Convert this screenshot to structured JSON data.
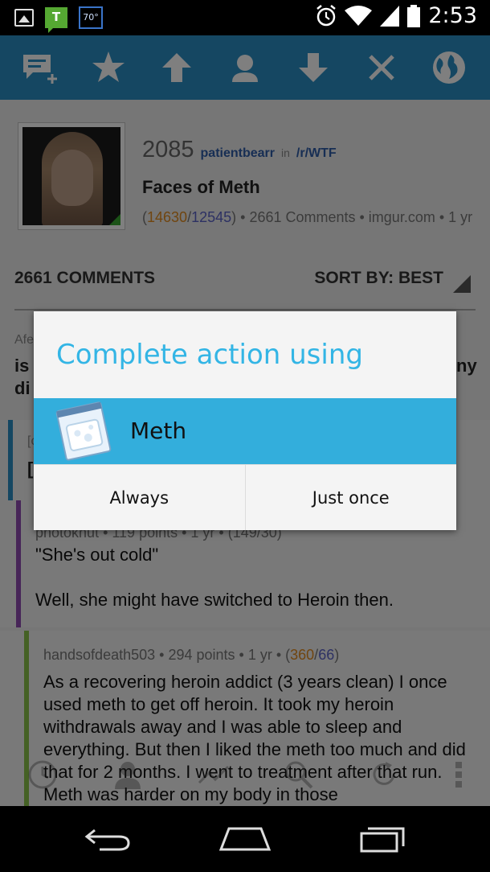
{
  "status_bar": {
    "temp_badge": "70°",
    "t_badge": "T",
    "time": "2:53",
    "icons": [
      "image-icon",
      "talk-icon",
      "weather-icon",
      "alarm-icon",
      "wifi-icon",
      "signal-icon",
      "battery-icon"
    ]
  },
  "toolbar": {
    "icons": [
      "add-comment-icon",
      "star-icon",
      "upvote-icon",
      "user-icon",
      "downvote-icon",
      "close-icon",
      "globe-icon"
    ],
    "color": "#2b8fc4"
  },
  "post": {
    "score": "2085",
    "author": "patientbearr",
    "in_label": "in",
    "subreddit": "/r/WTF",
    "title": "Faces of Meth",
    "meta_open": "(",
    "ups": "14630",
    "sep": "/",
    "downs": "12545",
    "meta_rest": ") • 2661 Comments • imgur.com • 1 yr"
  },
  "comments_header": {
    "count_label": "2661 COMMENTS",
    "sort_label": "SORT BY: BEST"
  },
  "obscured_fragments": {
    "a": "Afe",
    "b": "is",
    "c": "di",
    "d": "ny",
    "e": "[c",
    "f": "["
  },
  "comments": [
    {
      "head": "photoknut • 119 points • 1 yr • (149/30)",
      "lines": [
        "\"She's out cold\"",
        "Well, she might have switched to Heroin then."
      ]
    },
    {
      "author": "handsofdeath503",
      "head_rest": " • 294 points • 1 yr • (",
      "ups": "360",
      "sep": "/",
      "downs": "66",
      "close": ")",
      "body": "As a recovering heroin addict (3 years clean) I once used meth to get off heroin. It took my heroin withdrawals away and I was able to sleep and everything. But then I liked the meth too much and did that for 2 months. I went to treatment after that run. Meth was harder on my body in those"
    }
  ],
  "bottom_nav": {
    "icons": [
      "history-icon",
      "user-icon",
      "trend-icon",
      "search-icon",
      "refresh-icon",
      "overflow-menu-icon"
    ]
  },
  "dialog": {
    "title": "Complete action using",
    "app_label": "Meth",
    "always_label": "Always",
    "once_label": "Just once",
    "accent": "#33b5e5",
    "highlight": "#33aedc"
  },
  "nav_bar": {
    "icons": [
      "back-icon",
      "home-icon",
      "recents-icon"
    ]
  }
}
